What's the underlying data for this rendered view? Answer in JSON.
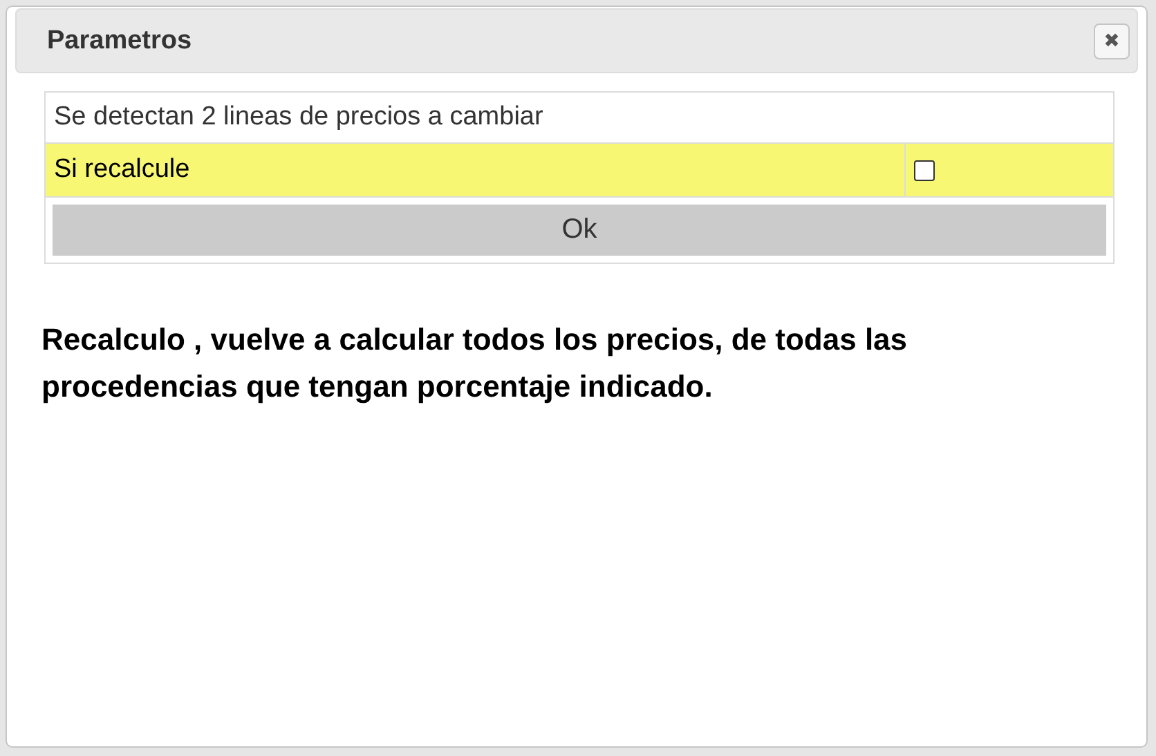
{
  "dialog": {
    "title": "Parametros",
    "close_icon": "✖",
    "message": "Se detectan 2 lineas de precios a cambiar",
    "option": {
      "label": "Si recalcule",
      "checked": false
    },
    "button": "Ok",
    "note": "Recalculo , vuelve a calcular todos los precios, de todas las procedencias que tengan porcentaje indicado."
  }
}
